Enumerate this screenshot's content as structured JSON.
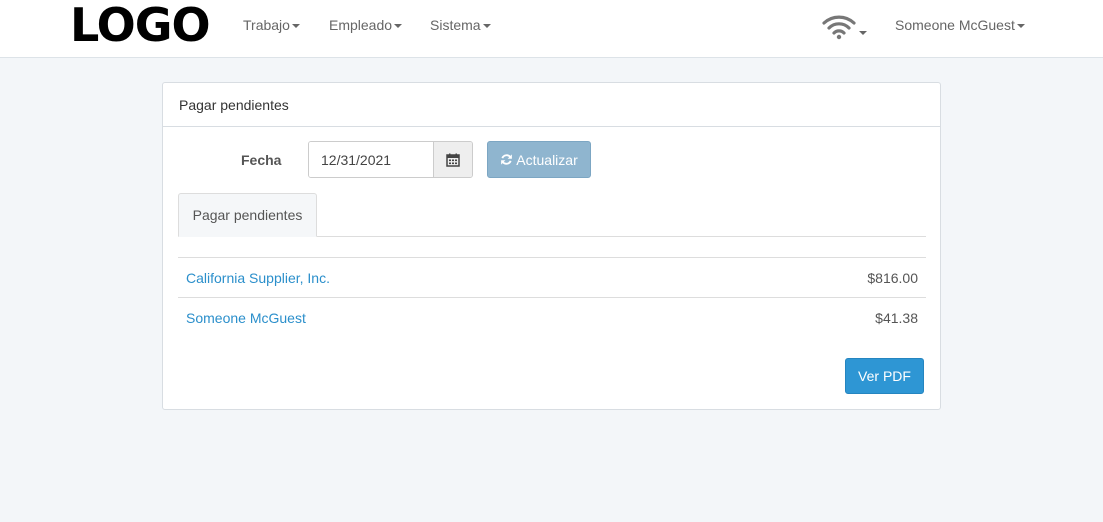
{
  "navbar": {
    "logo": "LOGO",
    "menus": [
      {
        "label": "Trabajo"
      },
      {
        "label": "Empleado"
      },
      {
        "label": "Sistema"
      }
    ],
    "wifi_icon": "wifi-icon",
    "user": "Someone McGuest"
  },
  "panel": {
    "title": "Pagar pendientes",
    "date_label": "Fecha",
    "date_value": "12/31/2021",
    "calendar_icon": "calendar-icon",
    "refresh_button": "Actualizar",
    "refresh_icon": "refresh-icon",
    "tabs": [
      {
        "label": "Pagar pendientes"
      }
    ],
    "rows": [
      {
        "name": "California Supplier, Inc.",
        "amount": "$816.00"
      },
      {
        "name": "Someone McGuest",
        "amount": "$41.38"
      }
    ],
    "pdf_button": "Ver PDF"
  },
  "colors": {
    "background": "#f3f6f9",
    "link": "#2b8fcb",
    "primary_button": "#2e96d4",
    "refresh_button": "#8fb5cf"
  }
}
